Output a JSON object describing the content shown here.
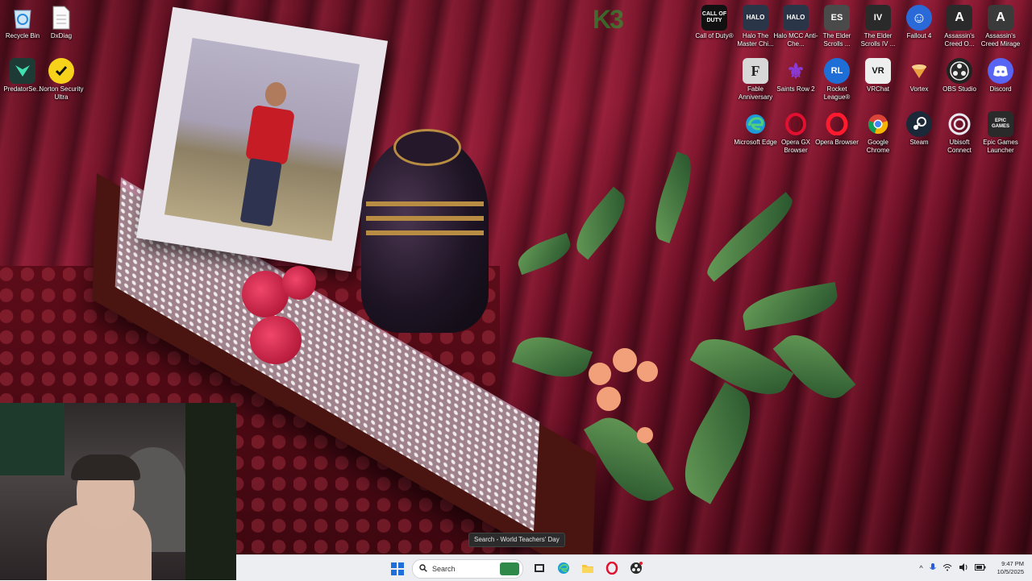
{
  "desktop": {
    "icons_left": [
      {
        "label": "Recycle Bin",
        "icon": "recycle-bin-icon",
        "color": "#3a8fd8"
      },
      {
        "label": "DxDiag",
        "icon": "document-icon",
        "color": "#f4f4f4"
      },
      {
        "label": "PredatorSe...",
        "icon": "predator-sense-icon",
        "color": "#1e3a34"
      },
      {
        "label": "Norton Security Ultra",
        "icon": "norton-icon",
        "color": "#f7d21a"
      }
    ],
    "icons_right": [
      {
        "label": "Call of Duty®",
        "glyph": "CALL OF DUTY",
        "color": "#111111"
      },
      {
        "label": "Halo The Master Chi...",
        "glyph": "HALO",
        "color": "#2a3548"
      },
      {
        "label": "Halo MCC Anti-Che...",
        "glyph": "HALO",
        "color": "#2a3548"
      },
      {
        "label": "The Elder Scrolls ...",
        "glyph": "ES",
        "color": "#4a4a4a"
      },
      {
        "label": "The Elder Scrolls IV ...",
        "glyph": "IV",
        "color": "#2a2a2a"
      },
      {
        "label": "Fallout 4",
        "glyph": "☺",
        "color": "#2a6ad8"
      },
      {
        "label": "Assassin's Creed O...",
        "glyph": "A",
        "color": "#2a2a2a"
      },
      {
        "label": "Assassin's Creed Mirage",
        "glyph": "A",
        "color": "#3a3a3a"
      },
      {
        "label": "Fable Anniversary",
        "glyph": "F",
        "color": "#d8d8d8"
      },
      {
        "label": "Saints Row 2",
        "glyph": "⚜",
        "color": "#6a2aa8"
      },
      {
        "label": "Rocket League®",
        "glyph": "RL",
        "color": "#1e6ed8"
      },
      {
        "label": "VRChat",
        "glyph": "VR",
        "color": "#eeeeee"
      },
      {
        "label": "Vortex",
        "glyph": "V",
        "color": "#e8a040"
      },
      {
        "label": "OBS Studio",
        "glyph": "●",
        "color": "#222222"
      },
      {
        "label": "Discord",
        "glyph": "D",
        "color": "#5865f2"
      },
      {
        "label": "Microsoft Edge",
        "glyph": "e",
        "color": "#1e9ad8"
      },
      {
        "label": "Opera GX Browser",
        "glyph": "O",
        "color": "#e01030"
      },
      {
        "label": "Opera Browser",
        "glyph": "O",
        "color": "#e01030"
      },
      {
        "label": "Google Chrome",
        "glyph": "◉",
        "color": "#34a853"
      },
      {
        "label": "Steam",
        "glyph": "S",
        "color": "#1b2838"
      },
      {
        "label": "Ubisoft Connect",
        "glyph": "U",
        "color": "#0a5ad8"
      },
      {
        "label": "Epic Games Launcher",
        "glyph": "EPIC GAMES",
        "color": "#2a2a2a"
      }
    ],
    "overlay_logo": {
      "text": "K3"
    }
  },
  "tooltip": {
    "text": "Search - World Teachers' Day"
  },
  "taskbar": {
    "search_placeholder": "Search",
    "apps": [
      {
        "name": "task-view-icon",
        "glyph": "▢"
      },
      {
        "name": "edge-taskbar-icon",
        "glyph": "e"
      },
      {
        "name": "file-explorer-icon",
        "glyph": "▬"
      },
      {
        "name": "opera-taskbar-icon",
        "glyph": "O"
      },
      {
        "name": "obs-taskbar-icon",
        "glyph": "●"
      }
    ],
    "tray": {
      "chevron": "^",
      "time": "9:47 PM",
      "date": "10/5/2025"
    }
  }
}
